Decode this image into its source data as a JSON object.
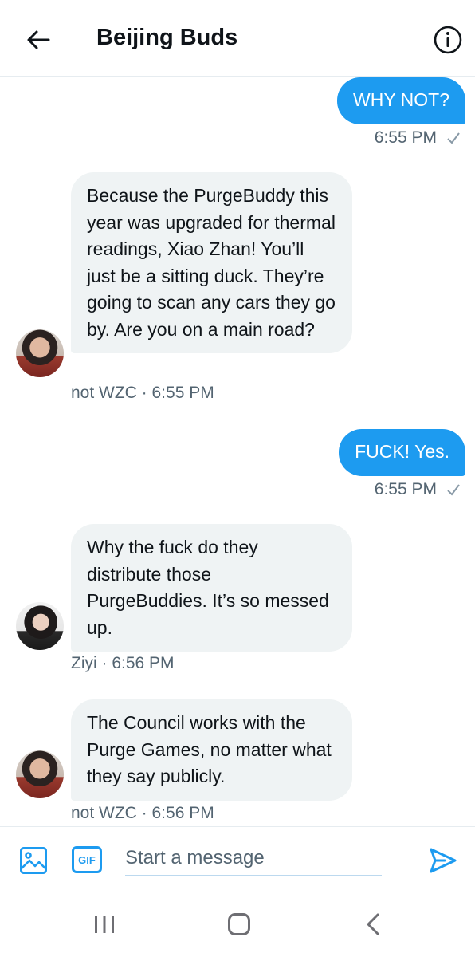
{
  "header": {
    "title": "Beijing Buds"
  },
  "messages": [
    {
      "direction": "out",
      "text": "WHY NOT?",
      "time": "6:55 PM"
    },
    {
      "direction": "in",
      "text": "Because the PurgeBuddy this year was upgraded for thermal readings, Xiao Zhan! You’ll just be a sitting duck. They’re going to scan any cars they go by. Are you on a main road?",
      "sender": "not WZC",
      "time_line": "not WZC · 6:55 PM"
    },
    {
      "direction": "out",
      "text": "FUCK! Yes.",
      "time": "6:55 PM"
    },
    {
      "direction": "in",
      "text": "Why the fuck do they distribute those PurgeBuddies. It’s so messed up.",
      "sender": "Ziyi",
      "time_line": "Ziyi · 6:56 PM"
    },
    {
      "direction": "in",
      "text": "The Council works with the Purge Games, no matter what they say publicly.",
      "sender": "not WZC",
      "time_line": "not WZC · 6:56 PM"
    }
  ],
  "composer": {
    "gif_label": "GIF",
    "placeholder": "Start a message",
    "value": ""
  },
  "icons": {
    "back": "arrow-left-icon",
    "info": "info-circle-icon",
    "read": "checkmark-icon",
    "media": "image-icon",
    "send": "paper-plane-icon",
    "nav_recents": "recents-icon",
    "nav_home": "home-icon",
    "nav_back": "chevron-left-icon"
  },
  "colors": {
    "accent": "#1d9bf0",
    "incoming_bubble": "#eff3f4",
    "meta_text": "#536471"
  }
}
